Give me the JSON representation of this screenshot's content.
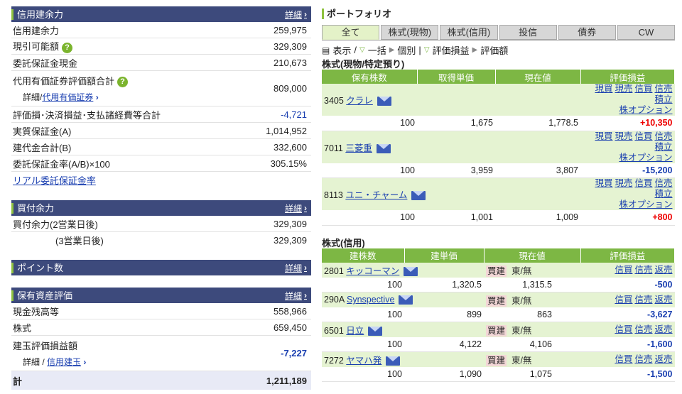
{
  "margin": {
    "title": "信用建余力",
    "detail": "詳細",
    "rows": [
      {
        "label": "信用建余力",
        "value": "259,975"
      },
      {
        "label": "現引可能額",
        "value": "329,309",
        "help": "?"
      },
      {
        "label": "委託保証金現金",
        "value": "210,673"
      }
    ],
    "substitute_label": "代用有価証券評価額合計",
    "substitute_sub": "詳細/",
    "substitute_link": "代用有価証券",
    "substitute_value": "809,000",
    "rows2": [
      {
        "label": "評価損･決済損益･支払諸経費等合計",
        "value": "-4,721"
      },
      {
        "label": "実質保証金(A)",
        "value": "1,014,952"
      },
      {
        "label": "建代金合計(B)",
        "value": "332,600"
      },
      {
        "label": "委託保証金率(A/B)×100",
        "value": "305.15%"
      }
    ],
    "realtime_link": "リアル委託保証金率"
  },
  "buying": {
    "title": "買付余力",
    "detail": "詳細",
    "rows": [
      {
        "label": "買付余力(2営業日後)",
        "value": "329,309"
      },
      {
        "label": "(3営業日後)",
        "value": "329,309"
      }
    ]
  },
  "points": {
    "title": "ポイント数",
    "detail": "詳細"
  },
  "assets": {
    "title": "保有資産評価",
    "detail": "詳細",
    "rows": [
      {
        "label": "現金残高等",
        "value": "558,966"
      },
      {
        "label": "株式",
        "value": "659,450"
      }
    ],
    "pl_label": "建玉評価損益額",
    "pl_sub": "詳細 / ",
    "pl_link": "信用建玉",
    "pl_value": "-7,227",
    "total_label": "計",
    "total_value": "1,211,189"
  },
  "portfolio": {
    "title": "ポートフォリオ",
    "tabs": [
      "全て",
      "株式(現物)",
      "株式(信用)",
      "投信",
      "債券",
      "CW"
    ],
    "filter": {
      "show": "表示",
      "collapse": "一括",
      "individual": "個別",
      "eval_pl": "評価損益",
      "eval_amount": "評価額"
    },
    "cash_section": "株式(現物/特定預り)",
    "cash_headers": [
      "保有株数",
      "取得単価",
      "現在値",
      "評価損益"
    ],
    "cash_actions": [
      "現買",
      "現売",
      "信買",
      "信売",
      "積立"
    ],
    "cash_option": "株オプション",
    "cash_rows": [
      {
        "code": "3405",
        "name": "クラレ",
        "qty": "100",
        "cost": "1,675",
        "price": "1,778.5",
        "pl": "+10,350"
      },
      {
        "code": "7011",
        "name": "三菱重",
        "qty": "100",
        "cost": "3,959",
        "price": "3,807",
        "pl": "-15,200"
      },
      {
        "code": "8113",
        "name": "ユニ・チャーム",
        "qty": "100",
        "cost": "1,001",
        "price": "1,009",
        "pl": "+800"
      }
    ],
    "margin_section": "株式(信用)",
    "margin_headers": [
      "建株数",
      "建単価",
      "現在値",
      "評価損益"
    ],
    "margin_actions": [
      "信買",
      "信売",
      "返売"
    ],
    "margin_rows": [
      {
        "code": "2801",
        "name": "キッコーマン",
        "side": "買建",
        "market": "東/無",
        "qty": "100",
        "cost": "1,320.5",
        "price": "1,315.5",
        "pl": "-500"
      },
      {
        "code": "290A",
        "name": "Synspective",
        "side": "買建",
        "market": "東/無",
        "qty": "100",
        "cost": "899",
        "price": "863",
        "pl": "-3,627"
      },
      {
        "code": "6501",
        "name": "日立",
        "side": "買建",
        "market": "東/無",
        "qty": "100",
        "cost": "4,122",
        "price": "4,106",
        "pl": "-1,600"
      },
      {
        "code": "7272",
        "name": "ヤマハ発",
        "side": "買建",
        "market": "東/無",
        "qty": "100",
        "cost": "1,090",
        "price": "1,075",
        "pl": "-1,500"
      }
    ]
  }
}
